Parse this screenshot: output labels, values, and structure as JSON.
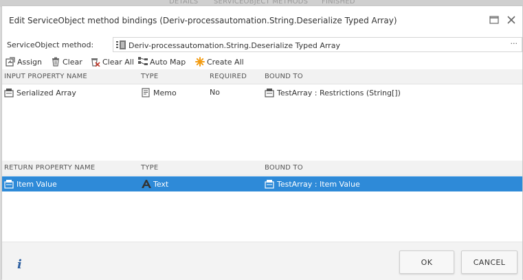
{
  "backdrop": {
    "tabs": [
      "DETAILS",
      "SERVICEOBJECT METHODS",
      "FINISHED"
    ]
  },
  "dialog": {
    "title": "Edit ServiceObject method bindings (Deriv-processautomation.String.Deserialize Typed Array)",
    "maximize_icon": "maximize-icon",
    "close_icon": "close-icon"
  },
  "method": {
    "label": "ServiceObject method:",
    "value": "Deriv-processautomation.String.Deserialize Typed Array",
    "more": "···"
  },
  "toolbar": {
    "assign": "Assign",
    "clear": "Clear",
    "clear_all": "Clear All",
    "auto_map": "Auto Map",
    "create_all": "Create All"
  },
  "input_grid": {
    "headers": {
      "name": "INPUT PROPERTY NAME",
      "type": "TYPE",
      "required": "REQUIRED",
      "bound": "BOUND TO"
    },
    "rows": [
      {
        "name": "Serialized Array",
        "type": "Memo",
        "required": "No",
        "bound": "TestArray : Restrictions (String[])"
      }
    ]
  },
  "return_grid": {
    "headers": {
      "name": "RETURN PROPERTY NAME",
      "type": "TYPE",
      "bound": "BOUND TO"
    },
    "rows": [
      {
        "name": "Item Value",
        "type": "Text",
        "bound": "TestArray : Item Value",
        "selected": true
      }
    ]
  },
  "footer": {
    "info": "i",
    "ok": "OK",
    "cancel": "CANCEL"
  },
  "colors": {
    "selection": "#2e8ad8",
    "accent_orange": "#f39c12",
    "clear_red": "#c0392b"
  }
}
